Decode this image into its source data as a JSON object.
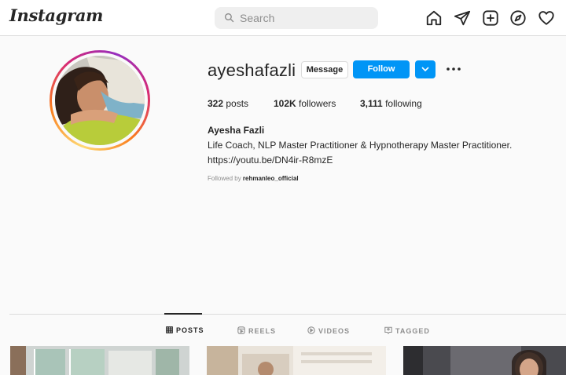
{
  "nav": {
    "logo": "Instagram",
    "search_placeholder": "Search",
    "icons": [
      "home-icon",
      "direct-icon",
      "new-post-icon",
      "explore-icon",
      "activity-icon"
    ]
  },
  "profile": {
    "username": "ayeshafazli",
    "message_label": "Message",
    "follow_label": "Follow",
    "posts_count": "322",
    "posts_label": "posts",
    "followers_count": "102K",
    "followers_label": "followers",
    "following_count": "3,111",
    "following_label": "following",
    "full_name": "Ayesha Fazli",
    "bio": "Life Coach, NLP Master Practitioner & Hypnotherapy Master Practitioner.",
    "link": "https://youtu.be/DN4ir-R8mzE",
    "followed_by_prefix": "Followed by",
    "followed_by_user": "rehmanleo_official"
  },
  "tabs": [
    {
      "label": "POSTS",
      "icon": "grid-icon",
      "active": true
    },
    {
      "label": "REELS",
      "icon": "reels-icon",
      "active": false
    },
    {
      "label": "VIDEOS",
      "icon": "video-icon",
      "active": false
    },
    {
      "label": "TAGGED",
      "icon": "tagged-icon",
      "active": false
    }
  ],
  "colors": {
    "accent": "#0095f6",
    "text": "#262626",
    "muted": "#8e8e8e",
    "border": "#dbdbdb",
    "background": "#fafafa"
  }
}
